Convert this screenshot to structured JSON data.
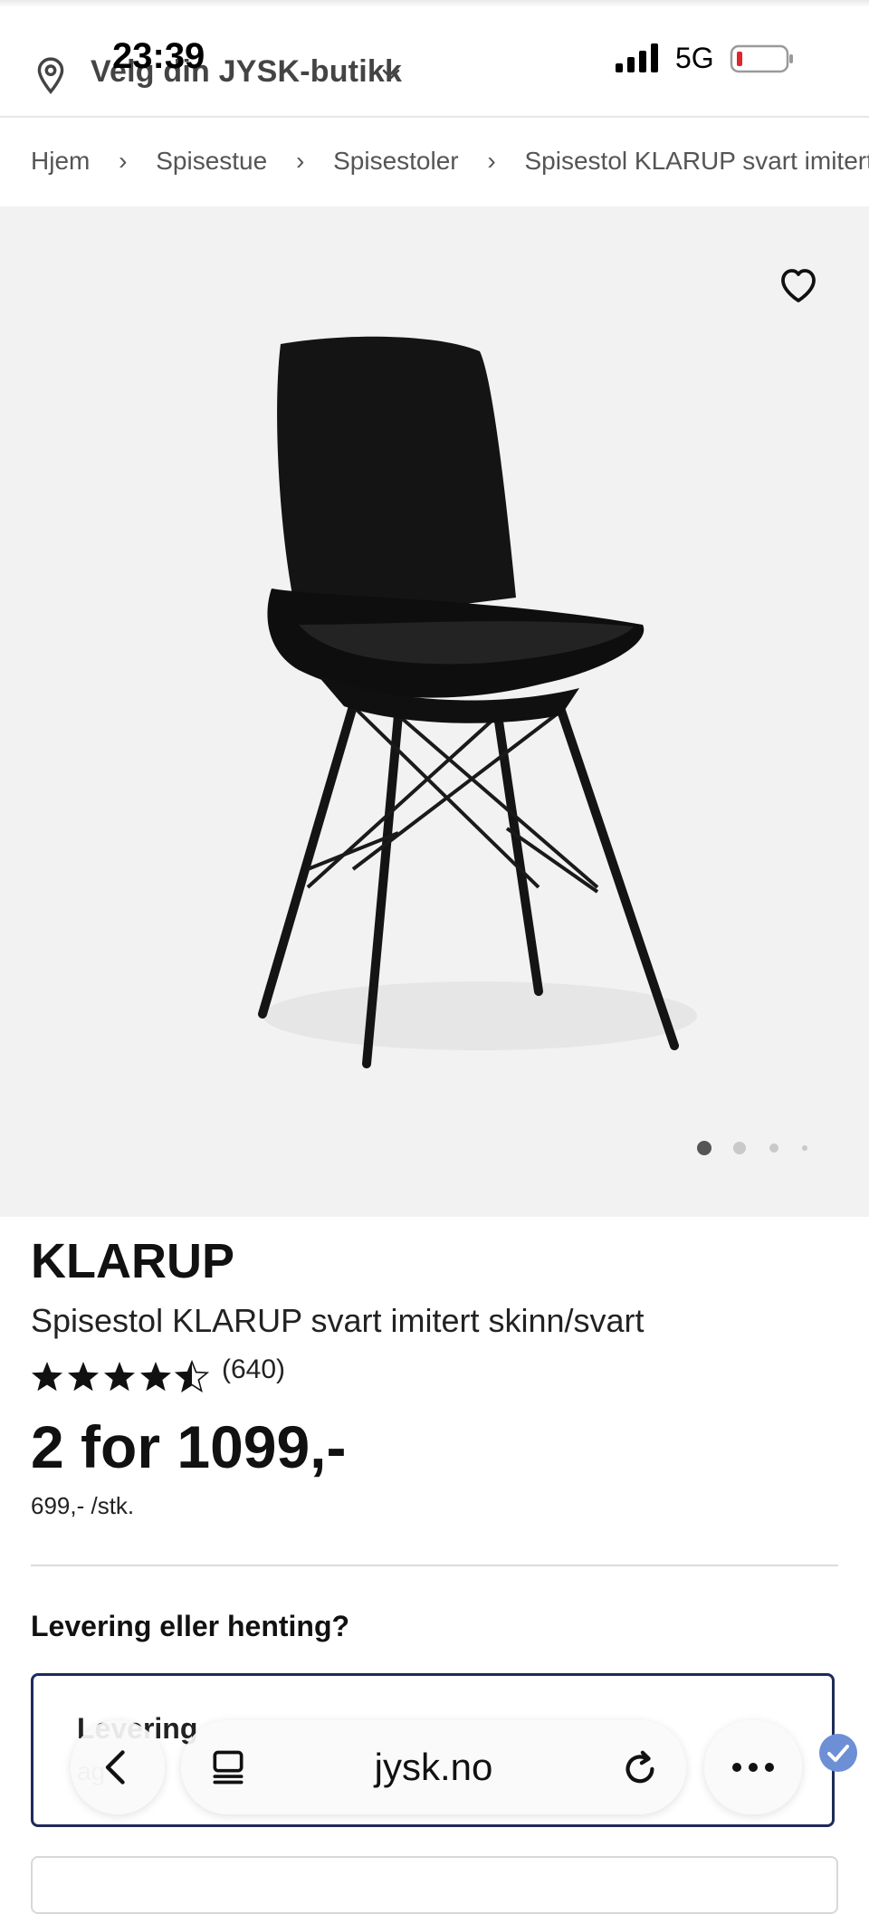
{
  "status_bar": {
    "time": "23:39",
    "network": "5G",
    "signal_icon": "signal-bars-icon",
    "battery_icon": "battery-low-icon"
  },
  "store_selector": {
    "label": "Velg din JYSK-butikk",
    "icon": "location-pin-icon"
  },
  "breadcrumb": {
    "items": [
      "Hjem",
      "Spisestue",
      "Spisestoler",
      "Spisestol KLARUP svart imitert skinn/svart"
    ]
  },
  "gallery": {
    "image_count": 4,
    "active_index": 0
  },
  "product": {
    "brand": "KLARUP",
    "name": "Spisestol KLARUP svart imitert skinn/svart",
    "rating": 4.5,
    "rating_max": 5,
    "review_count": "(640)",
    "price": "2 for 1099,-",
    "unit_price": "699,- /stk."
  },
  "delivery": {
    "heading": "Levering eller henting?",
    "option_title": "Levering",
    "option_sub": "ag"
  },
  "browser": {
    "url": "jysk.no"
  },
  "colors": {
    "accent_border": "#1e2a5a",
    "gallery_bg": "#f2f2f2",
    "check_badge": "#6d8fd6"
  }
}
